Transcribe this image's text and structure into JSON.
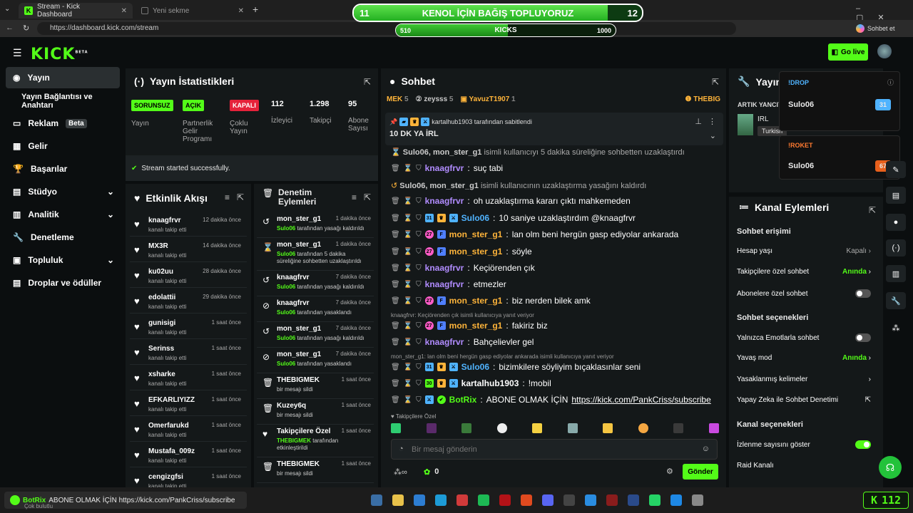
{
  "browser": {
    "tabs": [
      {
        "title": "Stream - Kick Dashboard",
        "active": true
      },
      {
        "title": "Yeni sekme",
        "active": false
      }
    ],
    "url": "https://dashboard.kick.com/stream",
    "profile_label": "Sohbet et"
  },
  "donation": {
    "title": "KENOL İÇİN BAĞIŞ TOPLUYORUZ",
    "left_num": "11",
    "right_num": "12",
    "progress": 0.88,
    "sub_label": "KICKS",
    "sub_left": "510",
    "sub_right": "1000",
    "sub_progress": 0.51
  },
  "header": {
    "logo": "KICK",
    "logo_beta": "BETA",
    "go_live": "Go live"
  },
  "sidebar": {
    "items": [
      {
        "label": "Yayın",
        "icon": "broadcast-icon",
        "active": true
      },
      {
        "label": "Yayın Bağlantısı ve Anahtarı",
        "icon": "",
        "active": false
      },
      {
        "label": "Reklam",
        "icon": "ad-icon",
        "badge": "Beta"
      },
      {
        "label": "Gelir",
        "icon": "revenue-icon"
      },
      {
        "label": "Başarılar",
        "icon": "trophy-icon"
      },
      {
        "label": "Stüdyo",
        "icon": "studio-icon",
        "chevron": true
      },
      {
        "label": "Analitik",
        "icon": "analytics-icon",
        "chevron": true
      },
      {
        "label": "Denetleme",
        "icon": "wrench-icon"
      },
      {
        "label": "Topluluk",
        "icon": "community-icon",
        "chevron": true
      },
      {
        "label": "Droplar ve ödüller",
        "icon": "gift-icon"
      }
    ]
  },
  "stats": {
    "title": "Yayın İstatistikleri",
    "cells": [
      {
        "tag": "SORUNSUZ",
        "label": "Yayın"
      },
      {
        "tag": "AÇIK",
        "label": "Partnerlik Gelir Programı"
      },
      {
        "tag": "KAPALI",
        "label": "Çoklu Yayın"
      },
      {
        "value": "112",
        "label": "İzleyici"
      },
      {
        "value": "1.298",
        "label": "Takipçi"
      },
      {
        "value": "95",
        "label": "Abone Sayısı"
      }
    ],
    "status": "Stream started successfully."
  },
  "activity": {
    "title": "Etkinlik Akışı",
    "sub": "kanalı takip etti",
    "items": [
      {
        "name": "knaagfrvr",
        "time": "12 dakika önce"
      },
      {
        "name": "MX3R",
        "time": "14 dakika önce"
      },
      {
        "name": "ku02uu",
        "time": "28 dakika önce"
      },
      {
        "name": "edolattii",
        "time": "29 dakika önce"
      },
      {
        "name": "gunisigi",
        "time": "1 saat önce"
      },
      {
        "name": "Serinss",
        "time": "1 saat önce"
      },
      {
        "name": "xsharke",
        "time": "1 saat önce"
      },
      {
        "name": "EFKARLIYIZZ",
        "time": "1 saat önce"
      },
      {
        "name": "Omerfarukd",
        "time": "1 saat önce"
      },
      {
        "name": "Mustafa_009z",
        "time": "1 saat önce"
      },
      {
        "name": "cengizgfsi",
        "time": "1 saat önce"
      }
    ]
  },
  "moderation": {
    "title1": "Denetim",
    "title2": "Eylemleri",
    "items": [
      {
        "icon": "undo-icon",
        "name": "mon_ster_g1",
        "time": "1 dakika önce",
        "by": "Sulo06",
        "rest": " tarafından yasağı kaldırıldı"
      },
      {
        "icon": "hourglass-icon",
        "name": "mon_ster_g1",
        "time": "1 dakika önce",
        "by": "Sulo06",
        "rest": " tarafından 5 dakika süreliğine sohbetten uzaklaştırıldı"
      },
      {
        "icon": "undo-icon",
        "name": "knaagfrvr",
        "time": "7 dakika önce",
        "by": "Sulo06",
        "rest": " tarafından yasağı kaldırıldı"
      },
      {
        "icon": "ban-icon",
        "name": "knaagfrvr",
        "time": "7 dakika önce",
        "by": "Sulo06",
        "rest": " tarafından yasaklandı"
      },
      {
        "icon": "undo-icon",
        "name": "mon_ster_g1",
        "time": "7 dakika önce",
        "by": "Sulo06",
        "rest": " tarafından yasağı kaldırıldı"
      },
      {
        "icon": "ban-icon",
        "name": "mon_ster_g1",
        "time": "7 dakika önce",
        "by": "Sulo06",
        "rest": " tarafından yasaklandı"
      },
      {
        "icon": "trash-icon",
        "name": "THEBIGMEK",
        "time": "1 saat önce",
        "by": "",
        "rest": "bir mesajı sildi"
      },
      {
        "icon": "trash-icon",
        "name": "Kuzey6q",
        "time": "1 saat önce",
        "by": "",
        "rest": "bir mesajı sildi"
      },
      {
        "icon": "heart-icon",
        "name": "Takipçilere Özel",
        "time": "1 saat önce",
        "by": "THEBIGMEK",
        "rest": " tarafından etkinleştirildi"
      },
      {
        "icon": "trash-icon",
        "name": "THEBIGMEK",
        "time": "1 saat önce",
        "by": "",
        "rest": "bir mesajı sildi"
      }
    ]
  },
  "chat": {
    "title": "Sohbet",
    "top_users": [
      {
        "name": "MEK",
        "count": "5"
      },
      {
        "name": "zeysss",
        "count": "5"
      },
      {
        "name": "YavuzT1907",
        "count": "1"
      },
      {
        "name": "THEBIG",
        "count": ""
      }
    ],
    "pinned_by": "kartalhub1903 tarafından sabitlendi",
    "pinned_text": "10 DK YA İRL",
    "sys1_users": "Sulo06, mon_ster_g1",
    "sys1_rest": " isimli kullanıcıyı 5 dakika süreliğine sohbetten uzaklaştırdı",
    "sys2_users": "Sulo06, mon_ster_g1",
    "sys2_rest": " isimli kullanıcının uzaklaştırma yasağını kaldırdı",
    "reply1": "knaagfrvr: Keçiörenden çık isimli kullanıcıya yanıt veriyor",
    "reply2": "mon_ster_g1: lan olm beni hergün gasp ediyolar ankarada isimli kullanıcıya yanıt veriyor",
    "messages": [
      {
        "user": "knaagfrvr",
        "color": "#b18cff",
        "text": "suç tabi"
      },
      {
        "user": "knaagfrvr",
        "color": "#b18cff",
        "text": "oh uzaklaştırma kararı çıktı mahkemeden"
      },
      {
        "user": "Sulo06",
        "color": "#4fb3ff",
        "text": "10 saniye uzaklaştırdım @knaagfrvr"
      },
      {
        "user": "mon_ster_g1",
        "color": "#ffb43a",
        "text": "lan olm beni hergün gasp ediyolar ankarada"
      },
      {
        "user": "mon_ster_g1",
        "color": "#ffb43a",
        "text": "söyle"
      },
      {
        "user": "knaagfrvr",
        "color": "#b18cff",
        "text": "Keçiörenden çık"
      },
      {
        "user": "knaagfrvr",
        "color": "#b18cff",
        "text": "etmezler"
      },
      {
        "user": "mon_ster_g1",
        "color": "#ffb43a",
        "text": "biz nerden bilek amk"
      },
      {
        "user": "mon_ster_g1",
        "color": "#ffb43a",
        "text": "fakiriz biz"
      },
      {
        "user": "knaagfrvr",
        "color": "#b18cff",
        "text": "Bahçelievler gel"
      },
      {
        "user": "Sulo06",
        "color": "#4fb3ff",
        "text": "bizimkilere söyliyim bıçaklasınlar seni"
      },
      {
        "user": "kartalhub1903",
        "color": "#ffffff",
        "text": "!mobil"
      },
      {
        "user": "BotRix",
        "color": "#53fc18",
        "text": "ABONE OLMAK İÇİN",
        "link": "https://kick.com/PankCriss/subscribe"
      }
    ],
    "followers_only": "Takipçilere Özel",
    "input_placeholder": "Bir mesaj gönderin",
    "send": "Gönder",
    "count": "0"
  },
  "stream_info": {
    "title": "Yayın bilgisi",
    "category_label": "ARTIK YANCIY",
    "category": "IRL",
    "language": "Turkish"
  },
  "drops": [
    {
      "title": "!DROP",
      "user": "Sulo06",
      "count": "31"
    },
    {
      "title": "!ROKET",
      "user": "Sulo06",
      "count": "67"
    }
  ],
  "channel": {
    "title": "Kanal Eylemleri",
    "chat_access": "Sohbet erişimi",
    "account_age": "Hesap yaşı",
    "account_age_val": "Kapalı",
    "followers_chat": "Takipçilere özel sohbet",
    "followers_chat_val": "Anında",
    "subs_chat": "Abonelere özel sohbet",
    "chat_options": "Sohbet seçenekleri",
    "emote_only": "Yalnızca Emotlarla sohbet",
    "slow_mode": "Yavaş mod",
    "slow_mode_val": "Anında",
    "banned_words": "Yasaklanmış kelimeler",
    "ai_mod": "Yapay Zeka ile Sohbet Denetimi",
    "channel_options": "Kanal seçenekleri",
    "show_viewers": "İzlenme sayısını göster",
    "raid": "Raid Kanalı"
  },
  "taskbar": {
    "notify_user": "BotRix",
    "notify_text": "ABONE OLMAK İÇİN https://kick.com/PankCriss/subscribe",
    "weather": "Çok bulutlu",
    "viewer_count": "112"
  }
}
